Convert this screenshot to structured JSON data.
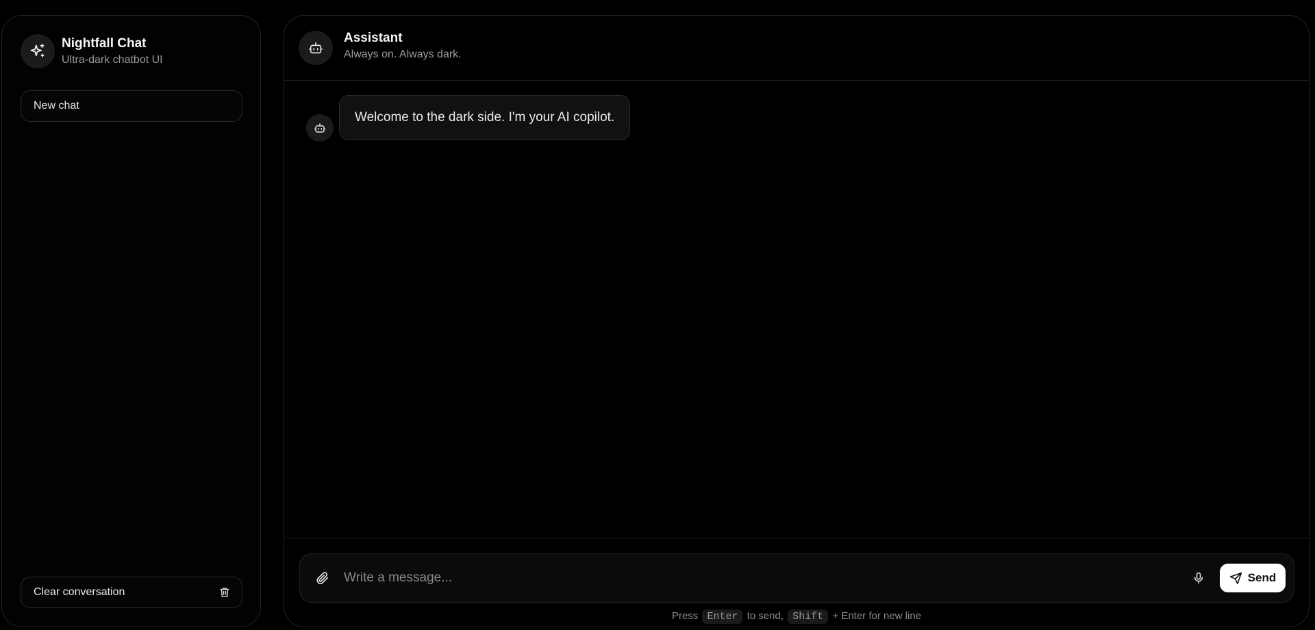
{
  "sidebar": {
    "brand_title": "Nightfall Chat",
    "brand_subtitle": "Ultra-dark chatbot UI",
    "brand_icon": "sparkles-icon",
    "new_chat_label": "New chat",
    "clear_label": "Clear conversation",
    "clear_icon": "trash-icon"
  },
  "header": {
    "title": "Assistant",
    "subtitle": "Always on. Always dark.",
    "icon": "bot-icon"
  },
  "messages": [
    {
      "role": "assistant",
      "text": "Welcome to the dark side. I'm your AI copilot."
    }
  ],
  "composer": {
    "placeholder": "Write a message...",
    "value": "",
    "send_label": "Send"
  },
  "hint": {
    "press": "Press",
    "key_enter": "Enter",
    "to_send": "to send,",
    "key_shift": "Shift",
    "newline": "+ Enter for new line"
  },
  "colors": {
    "background": "#000000",
    "panel_border": "#232323",
    "bubble": "#111111",
    "send_button": "#ffffff",
    "muted_text": "#9a9a9a"
  }
}
